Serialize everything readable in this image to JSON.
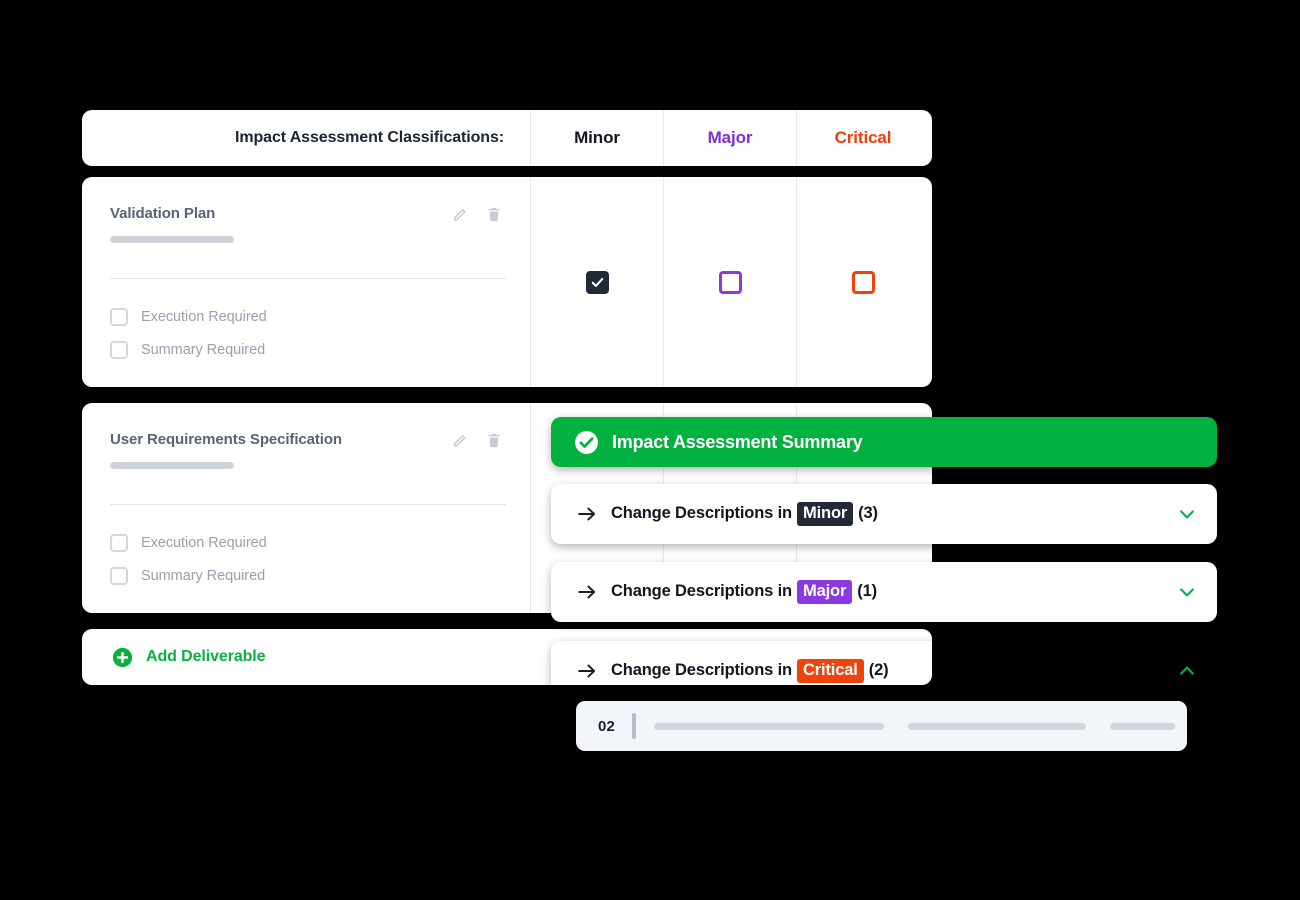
{
  "header": {
    "label": "Impact Assessment Classifications:",
    "columns": [
      {
        "name": "minor",
        "label": "Minor",
        "color": "#14161f"
      },
      {
        "name": "major",
        "label": "Major",
        "color": "#7b2fd6"
      },
      {
        "name": "critical",
        "label": "Critical",
        "color": "#f03d0b"
      }
    ]
  },
  "deliverables": [
    {
      "title": "Validation Plan",
      "requirements": [
        {
          "label": "Execution Required",
          "checked": false
        },
        {
          "label": "Summary Required",
          "checked": false
        }
      ],
      "classifications": [
        {
          "column": "minor",
          "checked": true
        },
        {
          "column": "major",
          "checked": false
        },
        {
          "column": "critical",
          "checked": false
        }
      ],
      "edit_icon": "pencil-icon",
      "delete_icon": "trash-icon"
    },
    {
      "title": "User Requirements Specification",
      "requirements": [
        {
          "label": "Execution Required",
          "checked": false
        },
        {
          "label": "Summary Required",
          "checked": false
        }
      ],
      "classifications": [
        {
          "column": "minor",
          "checked": false
        },
        {
          "column": "major",
          "checked": false
        },
        {
          "column": "critical",
          "checked": false
        }
      ],
      "edit_icon": "pencil-icon",
      "delete_icon": "trash-icon"
    }
  ],
  "add_deliverable": {
    "label": "Add Deliverable",
    "icon": "plus-circle-icon",
    "color": "#0bb040"
  },
  "summary_panel": {
    "title": "Impact Assessment Summary",
    "icon": "check-circle-icon",
    "background": "#02b13f",
    "accordions": [
      {
        "prefix": "Change Descriptions in",
        "severity": "Minor",
        "severity_color": "#232936",
        "count": "(3)",
        "expanded": false,
        "chevron": "chevron-down-icon",
        "arrow": "arrow-right-icon"
      },
      {
        "prefix": "Change Descriptions in",
        "severity": "Major",
        "severity_color": "#8b3ae0",
        "count": "(1)",
        "expanded": false,
        "chevron": "chevron-down-icon",
        "arrow": "arrow-right-icon"
      },
      {
        "prefix": "Change Descriptions in",
        "severity": "Critical",
        "severity_color": "#f0430c",
        "count": "(2)",
        "expanded": true,
        "chevron": "chevron-up-icon",
        "arrow": "arrow-right-icon",
        "items": [
          {
            "number": "02",
            "description": ""
          }
        ]
      }
    ]
  }
}
